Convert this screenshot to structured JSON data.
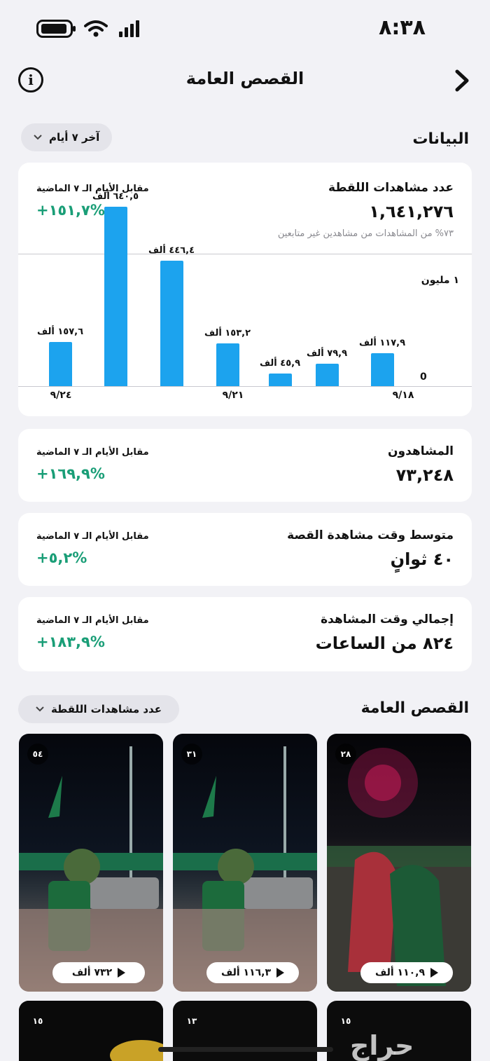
{
  "status_bar": {
    "time": "٨:٣٨"
  },
  "header": {
    "title": "القصص العامة"
  },
  "insights": {
    "section_title": "البيانات",
    "range_label": "آخر ٧ أيام"
  },
  "snap_views": {
    "label": "عدد مشاهدات اللقطة",
    "value": "١,٦٤١,٢٧٦",
    "sub": "٧٣% من المشاهدات من مشاهدين غير متابعين",
    "cmp_label": "مقابل الأيام الـ ٧ الماضية",
    "cmp_value": "+١٥١,٧%"
  },
  "chart_data": {
    "type": "bar",
    "y_axis_labels": [
      "١ مليون",
      "0"
    ],
    "ylim": [
      0,
      1000
    ],
    "x_tick_labels": [
      "٩/١٨",
      "٩/٢١",
      "٩/٢٤"
    ],
    "bars": [
      {
        "label": "١١٧,٩ ألف",
        "value": 117.9
      },
      {
        "label": "٧٩,٩ ألف",
        "value": 79.9
      },
      {
        "label": "٤٥,٩ ألف",
        "value": 45.9
      },
      {
        "label": "١٥٣,٢ ألف",
        "value": 153.2
      },
      {
        "label": "٤٤٦,٤ ألف",
        "value": 446.4
      },
      {
        "label": "٦٤٠,٥ ألف",
        "value": 640.5
      },
      {
        "label": "١٥٧,٦ ألف",
        "value": 157.6
      }
    ],
    "color": "#1ca3ee"
  },
  "viewers": {
    "label": "المشاهدون",
    "value": "٧٣,٢٤٨",
    "cmp_label": "مقابل الأيام الـ ٧ الماضية",
    "cmp_value": "+١٦٩,٩%"
  },
  "avg_view_time": {
    "label": "متوسط وقت مشاهدة القصة",
    "value": "٤٠ ثوانٍ",
    "cmp_label": "مقابل الأيام الـ ٧ الماضية",
    "cmp_value": "+٥,٢%"
  },
  "total_view_time": {
    "label": "إجمالي وقت المشاهدة",
    "value": "٨٢٤ من الساعات",
    "cmp_label": "مقابل الأيام الـ ٧ الماضية",
    "cmp_value": "+١٨٣,٩%"
  },
  "stories": {
    "section_title": "القصص العامة",
    "sort_label": "عدد مشاهدات اللقطة",
    "tiles": [
      {
        "count": "٥٤",
        "views": "٧٣٢ ألف"
      },
      {
        "count": "٣١",
        "views": "١١٦,٣ ألف"
      },
      {
        "count": "٢٨",
        "views": "١١٠,٩ ألف"
      }
    ],
    "tiles_row2": [
      {
        "count": "١٥"
      },
      {
        "count": "١٣"
      },
      {
        "count": "١٥"
      }
    ]
  },
  "watermark": "حراج",
  "colors": {
    "accent": "#1ca3ee",
    "positive": "#1a9e77",
    "background": "#f2f2f6"
  }
}
